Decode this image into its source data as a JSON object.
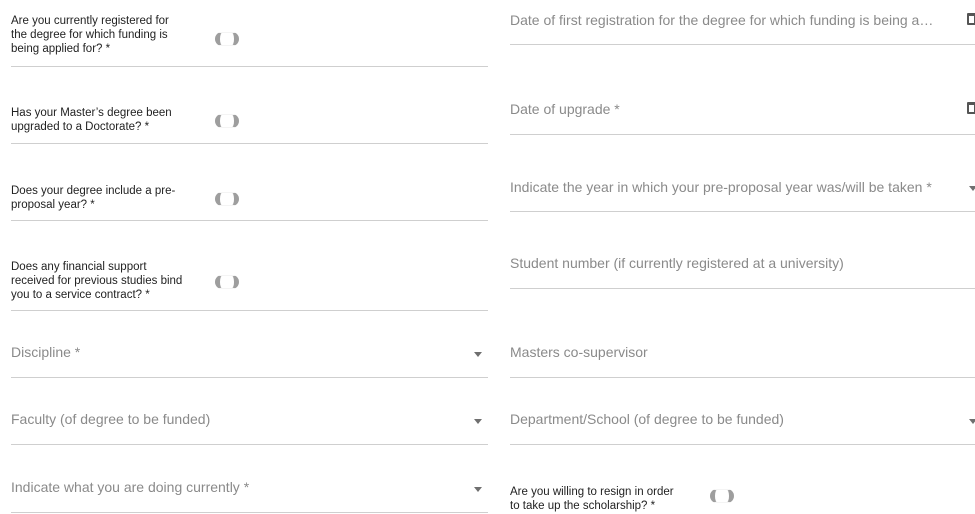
{
  "left": {
    "registered_question": [
      "Are you currently registered for",
      "the degree for which funding is",
      "being applied for? *"
    ],
    "upgraded_question": [
      "Has your Master’s degree been",
      "upgraded to a Doctorate? *"
    ],
    "preproposal_question": [
      "Does your degree include a pre-",
      "proposal year? *"
    ],
    "service_contract_question": [
      "Does any financial support",
      "received for previous studies bind",
      "you to a service contract? *"
    ],
    "discipline_placeholder": "Discipline *",
    "faculty_placeholder": "Faculty (of degree to be funded)",
    "current_activity_placeholder": "Indicate what you are doing currently *"
  },
  "right": {
    "first_registration_placeholder": "Date of first registration for the degree for which funding is being a…",
    "upgrade_date_placeholder": "Date of upgrade *",
    "preproposal_year_placeholder": "Indicate the year in which your pre-proposal year was/will be taken *",
    "student_number_placeholder": "Student number (if currently registered at a university)",
    "co_supervisor_placeholder": "Masters co-supervisor",
    "department_placeholder": "Department/School (of degree to be funded)",
    "resign_question": [
      "Are you willing to resign in order",
      "to take up the scholarship? *"
    ]
  },
  "icons": {
    "calendar": "calendar-icon",
    "dropdown": "chevron-down-icon",
    "toggle": "toggle-switch"
  },
  "colors": {
    "label": "#222222",
    "placeholder": "#8a8a8a",
    "underline": "#cfcfcf",
    "toggle_off": "#9e9e9e"
  }
}
